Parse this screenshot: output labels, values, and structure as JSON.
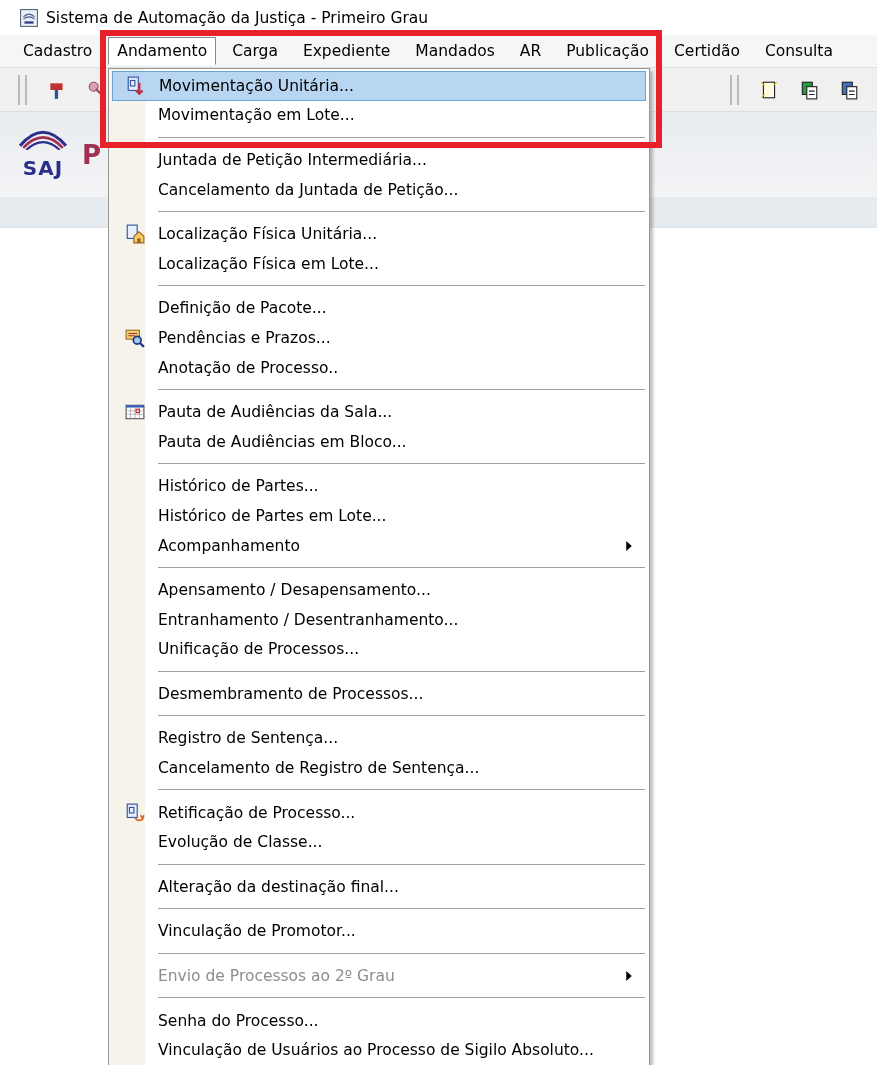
{
  "window": {
    "title": "Sistema de Automação da Justiça - Primeiro Grau"
  },
  "menubar": [
    {
      "label": "Cadastro",
      "selected": false
    },
    {
      "label": "Andamento",
      "selected": true
    },
    {
      "label": "Carga",
      "selected": false
    },
    {
      "label": "Expediente",
      "selected": false
    },
    {
      "label": "Mandados",
      "selected": false
    },
    {
      "label": "AR",
      "selected": false
    },
    {
      "label": "Publicação",
      "selected": false
    },
    {
      "label": "Certidão",
      "selected": false
    },
    {
      "label": "Consulta",
      "selected": false
    }
  ],
  "logo": {
    "text": "SAJ",
    "heading": "P"
  },
  "menu": {
    "sections": [
      [
        {
          "label": "Movimentação Unitária...",
          "kind": "movement",
          "selected": true,
          "submenu": false,
          "disabled": false
        },
        {
          "label": "Movimentação em Lote...",
          "selected": false,
          "submenu": false,
          "disabled": false
        }
      ],
      [
        {
          "label": "Juntada de Petição Intermediária...",
          "selected": false,
          "submenu": false,
          "disabled": false
        },
        {
          "label": "Cancelamento da Juntada de Petição...",
          "selected": false,
          "submenu": false,
          "disabled": false
        }
      ],
      [
        {
          "label": "Localização Física Unitária...",
          "kind": "location",
          "selected": false,
          "submenu": false,
          "disabled": false
        },
        {
          "label": "Localização Física em Lote...",
          "selected": false,
          "submenu": false,
          "disabled": false
        }
      ],
      [
        {
          "label": "Definição de Pacote...",
          "selected": false,
          "submenu": false,
          "disabled": false
        },
        {
          "label": "Pendências e Prazos...",
          "kind": "search-note",
          "selected": false,
          "submenu": false,
          "disabled": false
        },
        {
          "label": "Anotação de Processo..",
          "selected": false,
          "submenu": false,
          "disabled": false
        }
      ],
      [
        {
          "label": "Pauta de Audiências da Sala...",
          "kind": "calendar",
          "selected": false,
          "submenu": false,
          "disabled": false
        },
        {
          "label": "Pauta de Audiências em Bloco...",
          "selected": false,
          "submenu": false,
          "disabled": false
        }
      ],
      [
        {
          "label": "Histórico de Partes...",
          "selected": false,
          "submenu": false,
          "disabled": false
        },
        {
          "label": "Histórico de Partes em Lote...",
          "selected": false,
          "submenu": false,
          "disabled": false
        },
        {
          "label": "Acompanhamento",
          "selected": false,
          "submenu": true,
          "disabled": false
        }
      ],
      [
        {
          "label": "Apensamento / Desapensamento...",
          "selected": false,
          "submenu": false,
          "disabled": false
        },
        {
          "label": "Entranhamento / Desentranhamento...",
          "selected": false,
          "submenu": false,
          "disabled": false
        },
        {
          "label": "Unificação de Processos...",
          "selected": false,
          "submenu": false,
          "disabled": false
        }
      ],
      [
        {
          "label": "Desmembramento de Processos...",
          "selected": false,
          "submenu": false,
          "disabled": false
        }
      ],
      [
        {
          "label": "Registro de Sentença...",
          "selected": false,
          "submenu": false,
          "disabled": false
        },
        {
          "label": "Cancelamento de Registro de Sentença...",
          "selected": false,
          "submenu": false,
          "disabled": false
        }
      ],
      [
        {
          "label": "Retificação de Processo...",
          "kind": "retify",
          "selected": false,
          "submenu": false,
          "disabled": false
        },
        {
          "label": "Evolução de Classe...",
          "selected": false,
          "submenu": false,
          "disabled": false
        }
      ],
      [
        {
          "label": "Alteração da destinação final...",
          "selected": false,
          "submenu": false,
          "disabled": false
        }
      ],
      [
        {
          "label": "Vinculação de Promotor...",
          "selected": false,
          "submenu": false,
          "disabled": false
        }
      ],
      [
        {
          "label": "Envio de Processos ao 2º Grau",
          "selected": false,
          "submenu": true,
          "disabled": true
        }
      ],
      [
        {
          "label": "Senha do Processo...",
          "selected": false,
          "submenu": false,
          "disabled": false
        },
        {
          "label": "Vinculação de Usuários ao Processo de Sigilo Absoluto...",
          "selected": false,
          "submenu": false,
          "disabled": false
        }
      ]
    ]
  }
}
